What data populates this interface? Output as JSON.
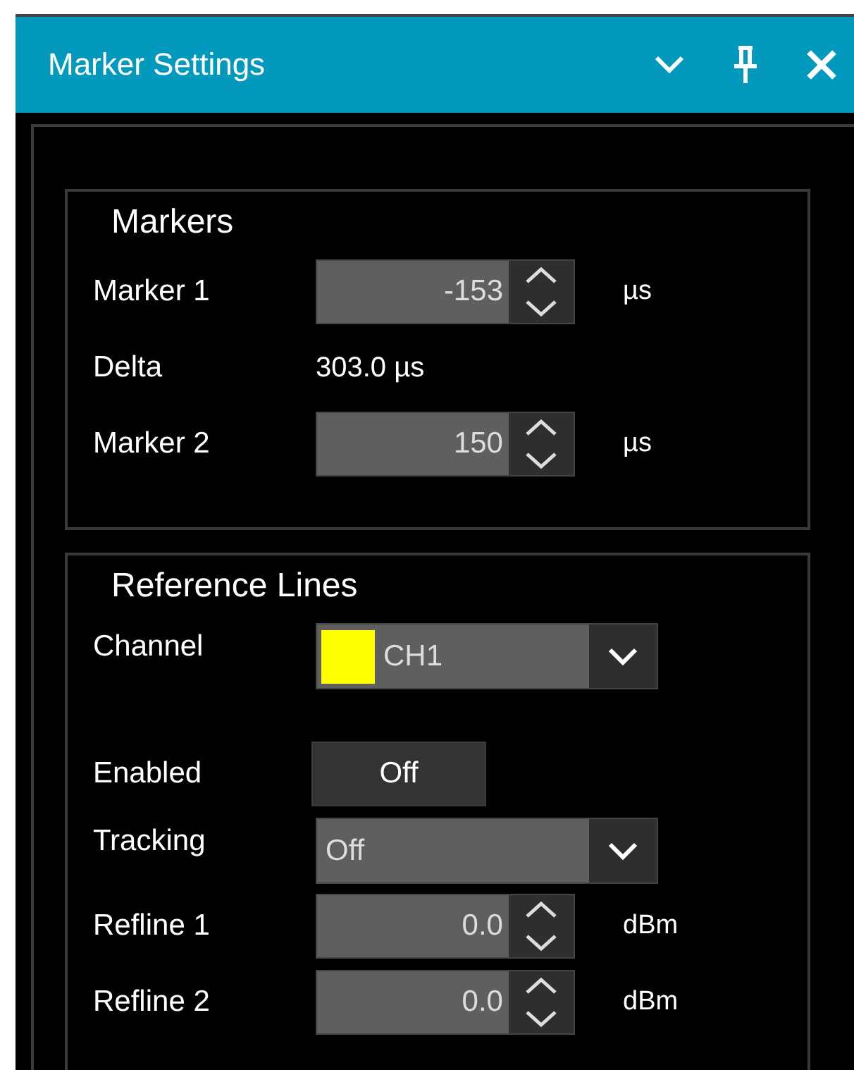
{
  "window": {
    "title": "Marker Settings"
  },
  "groups": [
    {
      "title": "Markers",
      "rows": [
        {
          "kind": "spin",
          "label": "Marker 1",
          "value": "-153",
          "unit": "µs"
        },
        {
          "kind": "readout",
          "label": "Delta",
          "value": "303.0 µs"
        },
        {
          "kind": "spin",
          "label": "Marker 2",
          "value": "150",
          "unit": "µs"
        }
      ]
    },
    {
      "title": "Reference Lines",
      "rows": [
        {
          "kind": "dropdown",
          "label": "Channel",
          "value": "CH1",
          "color": "#ffff00"
        },
        {
          "kind": "toggle",
          "label": "Enabled",
          "value": "Off",
          "on": false
        },
        {
          "kind": "dropdown",
          "label": "Tracking",
          "value": "Off"
        },
        {
          "kind": "spin",
          "label": "Refline 1",
          "value": "0.0",
          "unit": "dBm"
        },
        {
          "kind": "spin",
          "label": "Refline 2",
          "value": "0.0",
          "unit": "dBm"
        }
      ]
    }
  ]
}
